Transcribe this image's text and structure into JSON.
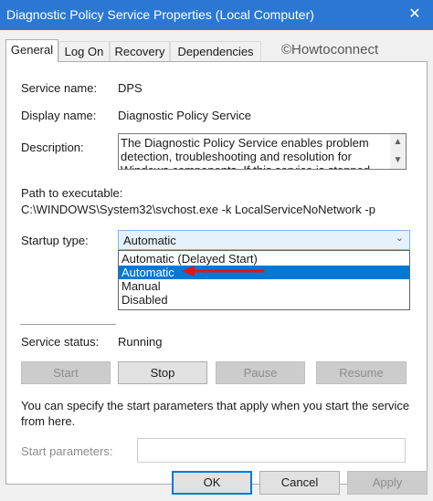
{
  "window": {
    "title": "Diagnostic Policy Service Properties (Local Computer)",
    "close_glyph": "✕"
  },
  "tabs": [
    {
      "label": "General",
      "active": true
    },
    {
      "label": "Log On",
      "active": false
    },
    {
      "label": "Recovery",
      "active": false
    },
    {
      "label": "Dependencies",
      "active": false
    }
  ],
  "watermark": "©Howtoconnect",
  "general": {
    "service_name_label": "Service name:",
    "service_name_value": "DPS",
    "display_name_label": "Display name:",
    "display_name_value": "Diagnostic Policy Service",
    "description_label": "Description:",
    "description_text": "The Diagnostic Policy Service enables problem detection, troubleshooting and resolution for Windows components.  If this service is stopped",
    "path_label": "Path to executable:",
    "path_value": "C:\\WINDOWS\\System32\\svchost.exe -k LocalServiceNoNetwork -p",
    "startup_label": "Startup type:",
    "startup_value": "Automatic",
    "startup_options": [
      "Automatic (Delayed Start)",
      "Automatic",
      "Manual",
      "Disabled"
    ],
    "startup_selected_index": 1,
    "status_label": "Service status:",
    "status_value": "Running"
  },
  "service_buttons": {
    "start": "Start",
    "stop": "Stop",
    "pause": "Pause",
    "resume": "Resume"
  },
  "info_text": "You can specify the start parameters that apply when you start the service from here.",
  "start_params": {
    "label": "Start parameters:",
    "value": ""
  },
  "footer": {
    "ok": "OK",
    "cancel": "Cancel",
    "apply": "Apply"
  },
  "icons": {
    "scroll_up": "▲",
    "scroll_down": "▼",
    "dropdown": "⌄"
  },
  "colors": {
    "titlebar": "#2b78d4",
    "selection": "#0078d7",
    "annotation_arrow": "#e0141e"
  }
}
